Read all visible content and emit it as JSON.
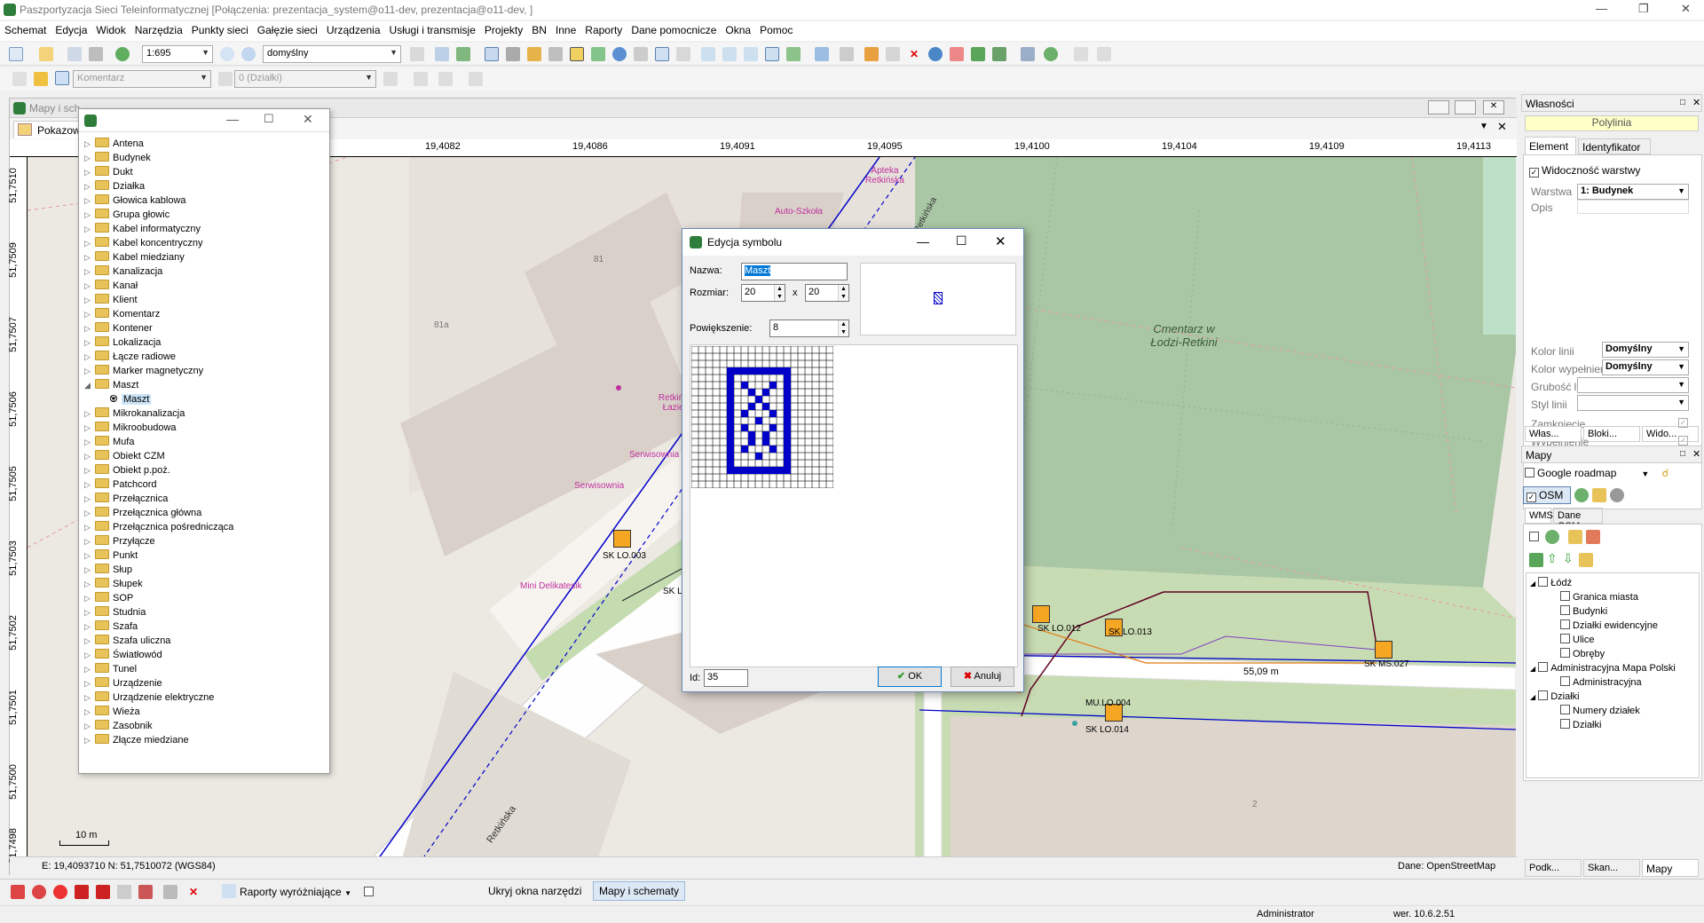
{
  "app": {
    "title": "Paszportyzacja Sieci Teleinformatycznej [Połączenia: prezentacja_system@o11-dev, prezentacja@o11-dev, ]"
  },
  "menu": [
    "Schemat",
    "Edycja",
    "Widok",
    "Narzędzia",
    "Punkty sieci",
    "Gałęzie sieci",
    "Urządzenia",
    "Usługi i transmisje",
    "Projekty",
    "BN",
    "Inne",
    "Raporty",
    "Dane pomocnicze",
    "Okna",
    "Pomoc"
  ],
  "toolbar": {
    "scale": "1:695",
    "style": "domyślny",
    "comment": "Komentarz",
    "layer": "0 (Działki)"
  },
  "mapwin": {
    "title": "Mapy i sch",
    "tab": "Pokazow",
    "ruler_x": [
      "19,4082",
      "19,4086",
      "19,4091",
      "19,4095",
      "19,4100",
      "19,4104",
      "19,4109",
      "19,4113"
    ],
    "ruler_y": [
      "51,7510",
      "51,7509",
      "51,7507",
      "51,7506",
      "51,7505",
      "51,7503",
      "51,7502",
      "51,7501",
      "51,7500",
      "51,7498"
    ],
    "status_coords": "E: 19,4093710  N: 51,7510072 (WGS84)",
    "status_source": "Dane: OpenStreetMap",
    "scalebar": "10 m"
  },
  "map_labels": {
    "apteka": "Apteka Retkińska",
    "autoszkola": "Auto-Szkoła",
    "n81": "81",
    "n81a": "81a",
    "lazienki": "Retkińskie Łazienki",
    "serwisownia1": "Serwisownia",
    "serwisownia2": "Serwisownia",
    "cmentarz": "Cmentarz w Łodzi-Retkini",
    "delikatesik": "Mini Delikatesik",
    "retkinska_v": "Retkińska",
    "retkinska": "Retkińska",
    "sk003": "SK LO.003",
    "sk_lo": "SK LO",
    "sk012": "SK LO.012",
    "sk013": "SK LO.013",
    "sk027": "SK MS.027",
    "sk014": "SK LO.014",
    "mu004": "MU.LO.004",
    "dist": "55,09 m",
    "n2": "2"
  },
  "tree": {
    "items": [
      "Antena",
      "Budynek",
      "Dukt",
      "Działka",
      "Głowica kablowa",
      "Grupa głowic",
      "Kabel informatyczny",
      "Kabel koncentryczny",
      "Kabel miedziany",
      "Kanalizacja",
      "Kanał",
      "Klient",
      "Komentarz",
      "Kontener",
      "Lokalizacja",
      "Łącze radiowe",
      "Marker magnetyczny",
      "Maszt",
      "Maszt",
      "Mikrokanalizacja",
      "Mikroobudowa",
      "Mufa",
      "Obiekt CZM",
      "Obiekt p.poż.",
      "Patchcord",
      "Przełącznica",
      "Przełącznica główna",
      "Przełącznica pośrednicząca",
      "Przyłącze",
      "Punkt",
      "Słup",
      "Słupek",
      "SOP",
      "Studnia",
      "Szafa",
      "Szafa uliczna",
      "Światłowód",
      "Tunel",
      "Urządzenie",
      "Urządzenie elektryczne",
      "Wieża",
      "Zasobnik",
      "Złącze miedziane"
    ]
  },
  "dialog": {
    "title": "Edycja symbolu",
    "name_label": "Nazwa:",
    "name_value": "Maszt",
    "size_label": "Rozmiar:",
    "width": "20",
    "x": "x",
    "height": "20",
    "zoom_label": "Powiększenie:",
    "zoom": "8",
    "id_label": "Id:",
    "id": "35",
    "ok": "OK",
    "cancel": "Anuluj"
  },
  "props": {
    "title": "Własności",
    "object": "Polylinia",
    "tab_element": "Element",
    "tab_ident": "Identyfikator",
    "layer_visibility": "Widoczność warstwy",
    "warstwa_label": "Warstwa",
    "warstwa_value": "1: Budynek",
    "opis_label": "Opis",
    "kolor_linii": "Kolor linii",
    "kolor_linii_val": "Domyślny",
    "kolor_wyp": "Kolor wypełnienia",
    "kolor_wyp_val": "Domyślny",
    "grubosc": "Grubość linii",
    "styl": "Styl linii",
    "zamkniecie": "Zamknięcie",
    "wypelnienie": "Wypełnienie",
    "tabs": [
      "Włas...",
      "Bloki...",
      "Wido..."
    ]
  },
  "mapy": {
    "title": "Mapy",
    "google": "Google  roadmap",
    "osm": "OSM",
    "tab_wms": "WMS",
    "tab_osm": "Dane OSM",
    "layers": [
      {
        "label": "Łódź",
        "level": 0
      },
      {
        "label": "Granica miasta",
        "level": 1
      },
      {
        "label": "Budynki",
        "level": 1
      },
      {
        "label": "Działki ewidencyjne",
        "level": 1
      },
      {
        "label": "Ulice",
        "level": 1
      },
      {
        "label": "Obręby",
        "level": 1
      },
      {
        "label": "Administracyjna Mapa Polski",
        "level": 0
      },
      {
        "label": "Administracyjna",
        "level": 1
      },
      {
        "label": "Działki",
        "level": 0
      },
      {
        "label": "Numery działek",
        "level": 1
      },
      {
        "label": "Działki",
        "level": 1
      }
    ],
    "tabs": [
      "Podk...",
      "Skan...",
      "Mapy"
    ]
  },
  "bottom": {
    "reports": "Raporty wyróżniające",
    "hide": "Ukryj okna narzędzi",
    "maps": "Mapy i schematy"
  },
  "status": {
    "user": "Administrator",
    "version": "wer. 10.6.2.51"
  },
  "colors": {
    "accent": "#0078d7",
    "cable_blue": "#0000cc",
    "symbol_blue": "#0000c8",
    "node_orange": "#f5a623",
    "park_green": "#c8dcb4",
    "cemetery": "#a9c7a4"
  }
}
